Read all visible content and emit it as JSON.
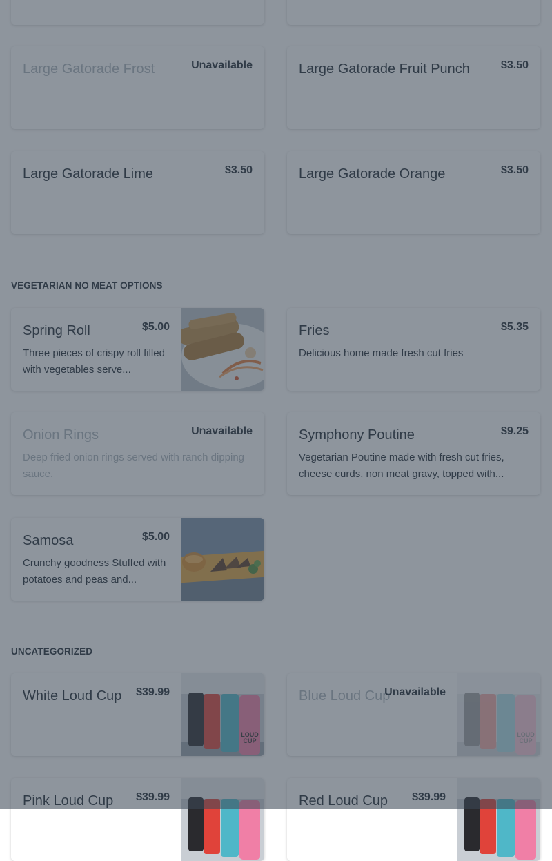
{
  "sections": {
    "vegetarian_title": "VEGETARIAN NO MEAT OPTIONS",
    "uncategorized_title": "UNCATEGORIZED"
  },
  "items": {
    "gatorade_frost": {
      "name": "Large Gatorade Frost",
      "price": "Unavailable"
    },
    "gatorade_fruit_punch": {
      "name": "Large Gatorade Fruit Punch",
      "price": "$3.50"
    },
    "gatorade_lime": {
      "name": "Large Gatorade Lime",
      "price": "$3.50"
    },
    "gatorade_orange": {
      "name": "Large Gatorade Orange",
      "price": "$3.50"
    },
    "spring_roll": {
      "name": "Spring Roll",
      "price": "$5.00",
      "desc": "Three pieces of crispy roll filled with vegetables serve..."
    },
    "fries": {
      "name": "Fries",
      "price": "$5.35",
      "desc": "Delicious home made fresh cut fries"
    },
    "onion_rings": {
      "name": "Onion Rings",
      "price": "Unavailable",
      "desc": "Deep fried onion rings served with ranch dipping sauce."
    },
    "symphony_poutine": {
      "name": "Symphony Poutine",
      "price": "$9.25",
      "desc": "Vegetarian Poutine made with fresh cut fries, cheese curds, non meat gravy, topped with..."
    },
    "samosa": {
      "name": "Samosa",
      "price": "$5.00",
      "desc": "Crunchy goodness Stuffed with potatoes and peas and..."
    },
    "white_loud_cup": {
      "name": "White Loud Cup",
      "price": "$39.99"
    },
    "blue_loud_cup": {
      "name": "Blue Loud Cup",
      "price": "Unavailable"
    },
    "pink_loud_cup": {
      "name": "Pink Loud Cup",
      "price": "$39.99"
    },
    "red_loud_cup": {
      "name": "Red Loud Cup",
      "price": "$39.99"
    }
  },
  "cup_labels": {
    "line1": "LOUD",
    "line2": "CUP"
  },
  "colors": {
    "overlay": "#3c4856",
    "text": "#1f2933",
    "unavailable_text": "#aab3bb",
    "card_bg": "#ffffff"
  }
}
